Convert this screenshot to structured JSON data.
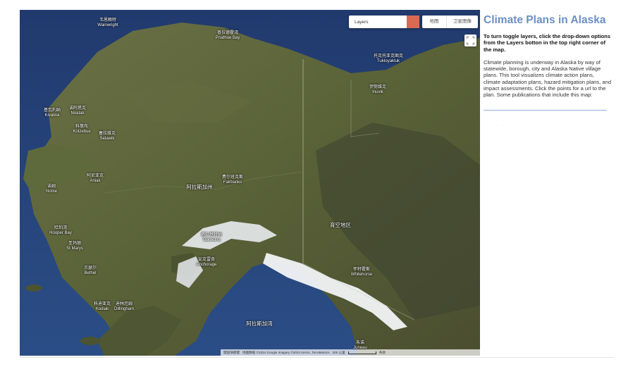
{
  "map": {
    "layers_label": "Layers",
    "map_type_buttons": [
      "地图",
      "卫星图像"
    ],
    "fullscreen_icon": "fullscreen-icon",
    "attribution": {
      "shortcuts": "键盘快捷键",
      "data": "地图数据 ©2024 Google Imagery ©2024 NASA, TerraMetrics",
      "scale": "200 公里",
      "terms": "条款"
    },
    "region_labels": [
      "阿拉斯加州",
      "育空地区",
      "阿拉斯加湾"
    ],
    "places": [
      {
        "zh": "韦恩赖特",
        "en": "Wainwright"
      },
      {
        "zh": "普拉德霍湾",
        "en": "Prudhoe Bay"
      },
      {
        "zh": "托克托亚克图克",
        "en": "Tuktoyaktuk"
      },
      {
        "zh": "伊努维克",
        "en": "Inuvik"
      },
      {
        "zh": "基瓦利纳",
        "en": "Kivalina"
      },
      {
        "zh": "诺阿塔克",
        "en": "Noatak"
      },
      {
        "zh": "科策布",
        "en": "Kotzebue"
      },
      {
        "zh": "塞拉维克",
        "en": "Selawik"
      },
      {
        "zh": "诺姆",
        "en": "Nome"
      },
      {
        "zh": "阿尼亚克",
        "en": "Aniak"
      },
      {
        "zh": "费尔班克斯",
        "en": "Fairbanks"
      },
      {
        "zh": "哈珀湾",
        "en": "Hooper Bay"
      },
      {
        "zh": "圣玛丽",
        "en": "St Marys"
      },
      {
        "zh": "贝瑟尔",
        "en": "Bethel"
      },
      {
        "zh": "塔尔基特纳",
        "en": "Talkeetna"
      },
      {
        "zh": "安克雷奇",
        "en": "Anchorage"
      },
      {
        "zh": "怀特霍斯",
        "en": "Whitehorse"
      },
      {
        "zh": "科迪亚克",
        "en": "Kodiak"
      },
      {
        "zh": "迪林厄姆",
        "en": "Dillingham"
      },
      {
        "zh": "朱诺",
        "en": "Juneau"
      }
    ]
  },
  "panel": {
    "title": "Climate Plans in Alaska",
    "instructions": "To turn toggle layers, click the drop-down options from the Layers botton in the top right corner of the map.",
    "description": "Climate planning is underway in Alaska by way of statewide, borough, city and Alaska Native village plans. This tool visualizes climate action plans, climate adaptation plans, hazard mitigation plans, and impact assessments. Click the points for a url to the plan. Some publications that include this map:",
    "faint_text": "· · · ·"
  },
  "colors": {
    "title": "#6a8fc6",
    "layers_dropdown": "#d86a54",
    "ocean": "#1e3566",
    "rule": "#8fb0dd"
  }
}
